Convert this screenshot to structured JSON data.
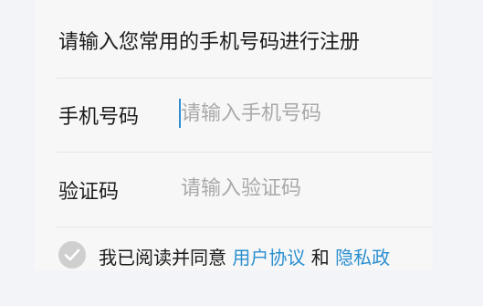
{
  "instruction": "请输入您常用的手机号码进行注册",
  "phone": {
    "label": "手机号码",
    "placeholder": "请输入手机号码",
    "value": ""
  },
  "code": {
    "label": "验证码",
    "placeholder": "请输入验证码",
    "value": ""
  },
  "agreement": {
    "checked": false,
    "prefix": "我已阅读并同意",
    "user_agreement_link": "用户协议",
    "conjunction": "和",
    "privacy_link": "隐私政"
  },
  "colors": {
    "accent": "#2a8fd0",
    "placeholder": "#a9a9a9",
    "check_inactive": "#cfcfcf",
    "background": "#f7f7f7"
  },
  "icons": {
    "agreement_checkbox": "checkmark-icon"
  }
}
